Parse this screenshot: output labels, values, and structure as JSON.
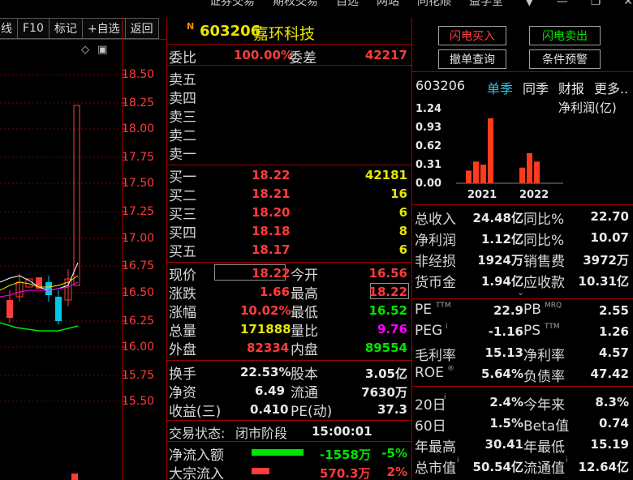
{
  "top_menu": [
    "证券交易",
    "期权交易",
    "自选",
    "网站",
    "同花顺",
    "益学堂"
  ],
  "toolbar": [
    "画线",
    "F10",
    "标记",
    "+自选",
    "返回"
  ],
  "price_axis": [
    "18.50",
    "18.25",
    "18.00",
    "17.75",
    "17.50",
    "17.25",
    "17.00",
    "16.75",
    "16.50",
    "16.25",
    "16.00",
    "15.75",
    "15.50"
  ],
  "stock": {
    "badge": "N",
    "code": "603206",
    "name": "嘉环科技"
  },
  "weibi": {
    "label1": "委比",
    "value1": "100.00%",
    "label2": "委差",
    "value2": "42217"
  },
  "asks": [
    {
      "label": "卖五"
    },
    {
      "label": "卖四"
    },
    {
      "label": "卖三"
    },
    {
      "label": "卖二"
    },
    {
      "label": "卖一"
    }
  ],
  "bids": [
    {
      "label": "买一",
      "price": "18.22",
      "vol": "42181"
    },
    {
      "label": "买二",
      "price": "18.21",
      "vol": "16"
    },
    {
      "label": "买三",
      "price": "18.20",
      "vol": "6"
    },
    {
      "label": "买四",
      "price": "18.18",
      "vol": "8"
    },
    {
      "label": "买五",
      "price": "18.17",
      "vol": "6"
    }
  ],
  "quote": [
    {
      "l1": "现价",
      "v1": "18.22",
      "l2": "今开",
      "v2": "16.56"
    },
    {
      "l1": "涨跌",
      "v1": "1.66",
      "l2": "最高",
      "v2": "18.22"
    },
    {
      "l1": "涨幅",
      "v1": "10.02%",
      "l2": "最低",
      "v2": "16.52"
    },
    {
      "l1": "总量",
      "v1": "171888",
      "l2": "量比",
      "v2": "9.76"
    },
    {
      "l1": "外盘",
      "v1": "82334",
      "l2": "内盘",
      "v2": "89554"
    }
  ],
  "stats": [
    {
      "l1": "换手",
      "v1": "22.53%",
      "l2": "股本",
      "v2": "3.05亿"
    },
    {
      "l1": "净资",
      "v1": "6.49",
      "l2": "流通",
      "v2": "7630万"
    },
    {
      "l1": "收益(三)",
      "v1": "0.410",
      "l2": "PE(动)",
      "v2": "37.3"
    }
  ],
  "trade_status": {
    "label": "交易状态:",
    "value": "闭市阶段",
    "time": "15:00:01"
  },
  "flows": [
    {
      "label": "净流入额",
      "value": "-1558万",
      "pct": "-5%",
      "bar_fraction": 1.0
    },
    {
      "label": "大宗流入",
      "value": "570.3万",
      "pct": "2%",
      "bar_fraction": 0.35
    }
  ],
  "buttons": {
    "flash_buy": "闪电买入",
    "flash_sell": "闪电卖出",
    "cancel_query": "撤单查询",
    "condition_alert": "条件预警"
  },
  "finance_tabs": {
    "code": "603206",
    "tab1": "单季",
    "tab2": "同季",
    "tab3": "财报",
    "more": "更多.."
  },
  "chart_data": {
    "type": "bar",
    "title": "净利润(亿)",
    "yticks": [
      "1.24",
      "0.93",
      "0.62",
      "0.31",
      "0.00"
    ],
    "ylim": [
      0,
      1.24
    ],
    "groups": [
      "2021",
      "2022"
    ],
    "values": [
      [
        0.21,
        0.36,
        0.31,
        1.08
      ],
      [
        0.26,
        0.5,
        0.36
      ]
    ]
  },
  "fin_rows": [
    {
      "l1": "总收入",
      "v1": "24.48亿",
      "l2": "同比%",
      "v2": "22.70"
    },
    {
      "l1": "净利润",
      "v1": "1.12亿",
      "l2": "同比%",
      "v2": "10.07"
    },
    {
      "l1": "非经损",
      "v1": "1924万",
      "l2": "销售费",
      "v2": "3972万"
    },
    {
      "l1": "货币金",
      "v1": "1.94亿",
      "l2": "应收款",
      "v2": "10.31亿"
    }
  ],
  "ratio_rows": [
    {
      "l1": "PE",
      "s1": "TTM",
      "v1": "22.9",
      "l2": "PB",
      "s2": "MRQ",
      "v2": "2.55"
    },
    {
      "l1": "PEG",
      "s1": "i",
      "v1": "-1.16",
      "l2": "PS",
      "s2": "TTM",
      "v2": "1.26"
    },
    {
      "l1": "毛利率",
      "s1": "",
      "v1": "15.13",
      "l2": "净利率",
      "s2": "",
      "v2": "4.57"
    },
    {
      "l1": "ROE",
      "s1": "®",
      "v1": "5.64%",
      "l2": "负债率",
      "s2": "",
      "v2": "47.42"
    }
  ],
  "perf_rows": [
    {
      "l1": "20日",
      "v1": "2.4%",
      "l2": "今年来",
      "v2": "8.3%"
    },
    {
      "l1": "60日",
      "v1": "1.5%",
      "l2": "Beta值",
      "v2": "0.74"
    },
    {
      "l1": "年最高",
      "v1": "30.41",
      "l2": "年最低",
      "v2": "15.19"
    },
    {
      "l1": "总市值",
      "v1": "50.54亿",
      "l2": "流通值",
      "v2": "12.64亿"
    }
  ]
}
